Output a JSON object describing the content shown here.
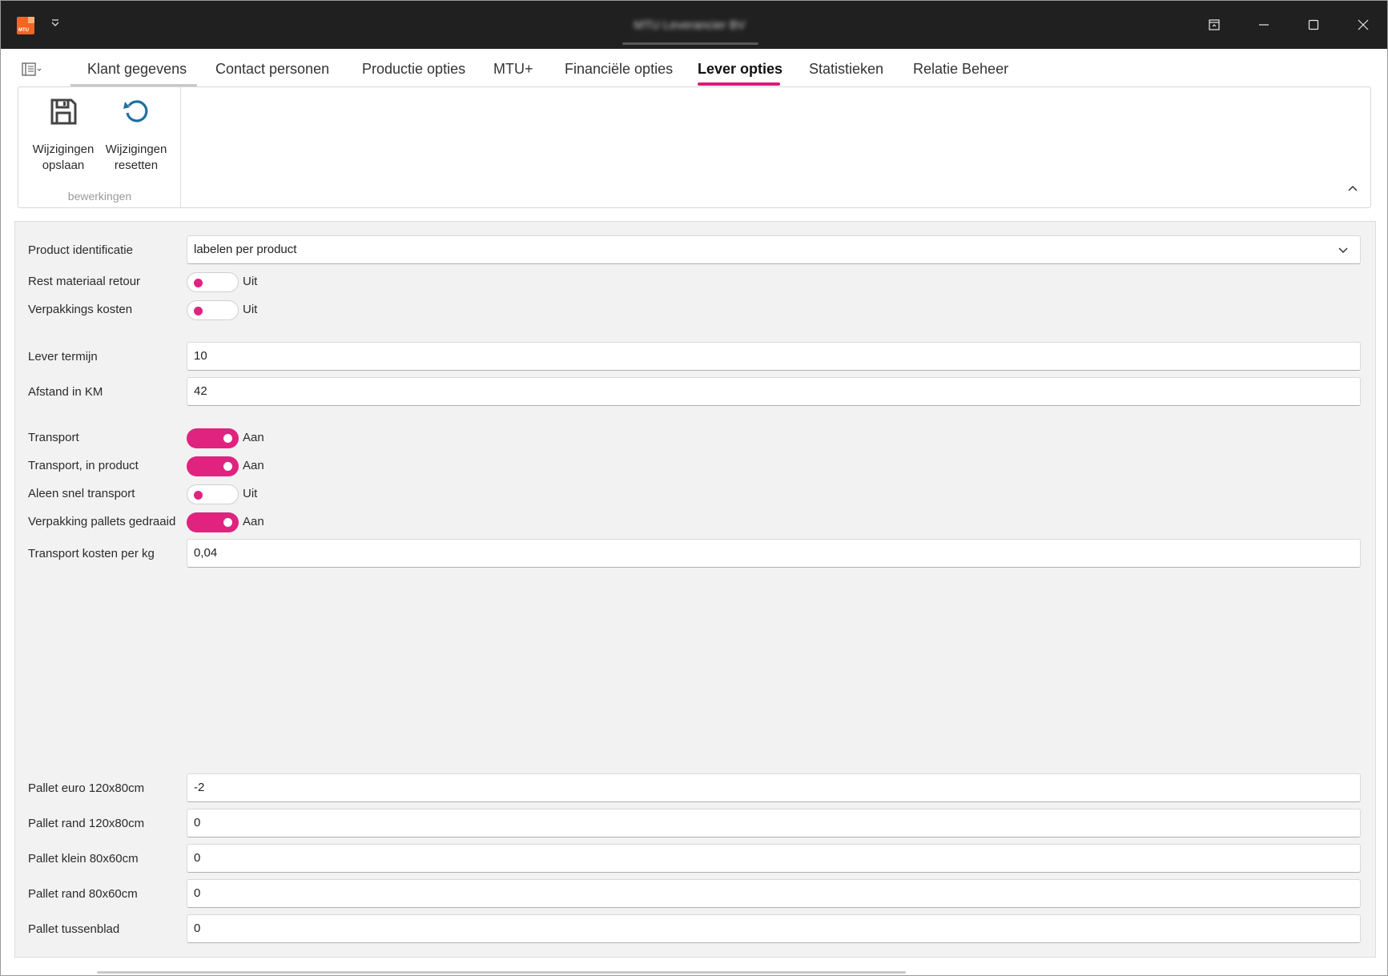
{
  "window": {
    "title": "MTU Leverancier BV",
    "logo_text": "MTU",
    "controls": {
      "restore_icon": "window-restore-icon",
      "minimize_icon": "minimize-icon",
      "maximize_icon": "maximize-icon",
      "close_icon": "close-icon"
    }
  },
  "tabs": [
    {
      "label": "Klant gegevens"
    },
    {
      "label": "Contact personen"
    },
    {
      "label": "Productie opties"
    },
    {
      "label": "MTU+"
    },
    {
      "label": "Financiële opties"
    },
    {
      "label": "Lever opties",
      "active": true
    },
    {
      "label": "Statistieken"
    },
    {
      "label": "Relatie Beheer"
    }
  ],
  "ribbon": {
    "group_label": "bewerkingen",
    "save": {
      "line1": "Wijzigingen",
      "line2": "opslaan"
    },
    "reset": {
      "line1": "Wijzigingen",
      "line2": "resetten"
    }
  },
  "form": {
    "product_identificatie": {
      "label": "Product identificatie",
      "value": "labelen per product"
    },
    "rest_materiaal_retour": {
      "label": "Rest materiaal retour",
      "state": "Uit"
    },
    "verpakkings_kosten": {
      "label": "Verpakkings kosten",
      "state": "Uit"
    },
    "lever_termijn": {
      "label": "Lever termijn",
      "value": "10"
    },
    "afstand_km": {
      "label": "Afstand in KM",
      "value": "42"
    },
    "transport": {
      "label": "Transport",
      "state": "Aan"
    },
    "transport_in_product": {
      "label": "Transport, in product",
      "state": "Aan"
    },
    "aleen_snel_transport": {
      "label": "Aleen snel transport",
      "state": "Uit"
    },
    "verpakking_pallets_gedraaid": {
      "label": "Verpakking pallets gedraaid",
      "state": "Aan"
    },
    "transport_kosten_per_kg": {
      "label": "Transport kosten per kg",
      "value": "0,04"
    },
    "pallet_euro": {
      "label": "Pallet euro 120x80cm",
      "value": "-2"
    },
    "pallet_rand_120": {
      "label": "Pallet rand 120x80cm",
      "value": "0"
    },
    "pallet_klein": {
      "label": "Pallet klein 80x60cm",
      "value": "0"
    },
    "pallet_rand_80": {
      "label": "Pallet rand 80x60cm",
      "value": "0"
    },
    "pallet_tussenblad": {
      "label": "Pallet tussenblad",
      "value": "0"
    }
  },
  "colors": {
    "accent": "#e0237f",
    "titlebar": "#202020",
    "panel": "#f2f2f2"
  }
}
